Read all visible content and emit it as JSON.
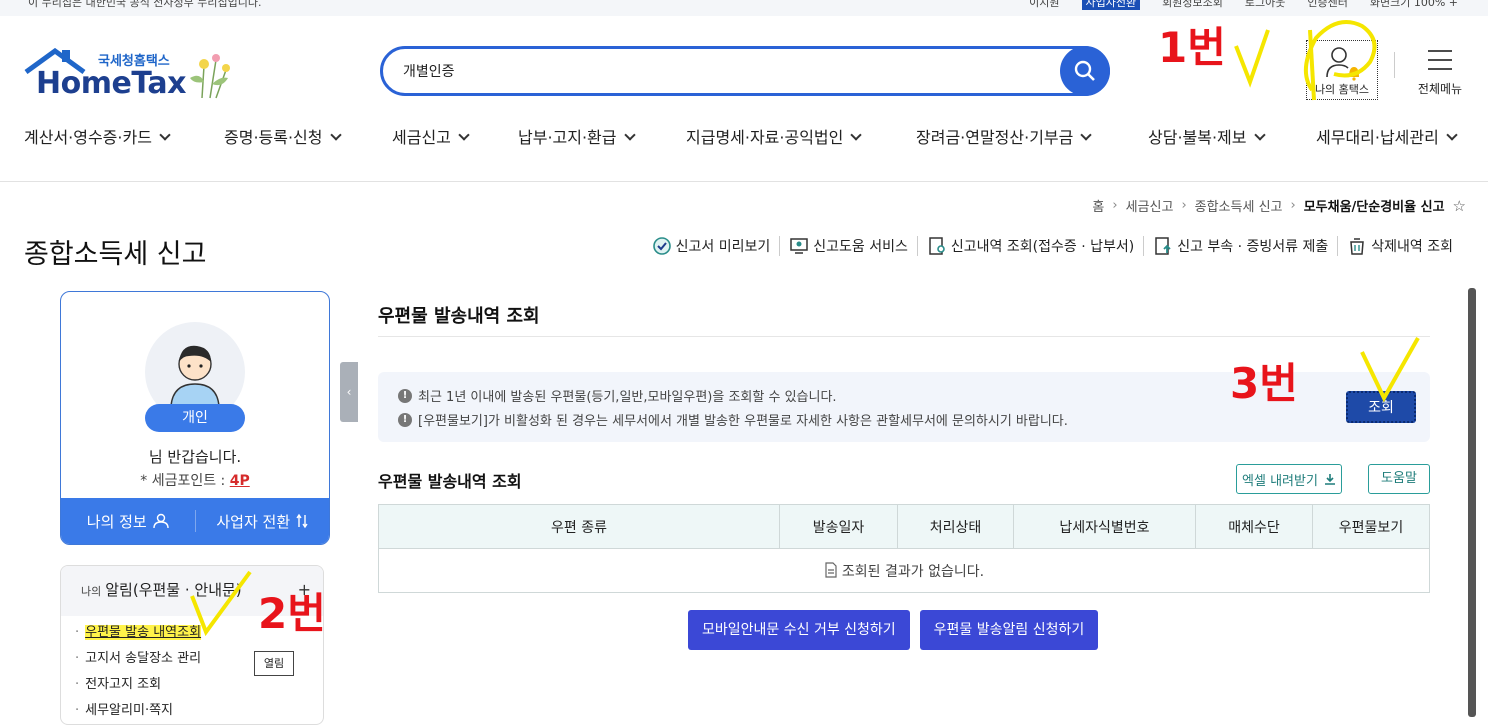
{
  "topbar": {
    "gov": "이 누리집은 대한민국 공식 전자정부 누리집입니다.",
    "links": [
      "이지원",
      "사업자전환",
      "회원정보조회",
      "로그아웃",
      "인증센터",
      "화면크기 100% +"
    ]
  },
  "logo": {
    "small": "국세청홈택스",
    "big": "HomeTax"
  },
  "search": {
    "value": "개별인증"
  },
  "header": {
    "my_hometax": "나의 홈택스",
    "all_menu": "전체메뉴"
  },
  "gnb": [
    "계산서·영수증·카드",
    "증명·등록·신청",
    "세금신고",
    "납부·고지·환급",
    "지급명세·자료·공익법인",
    "장려금·연말정산·기부금",
    "상담·불복·제보",
    "세무대리·납세관리"
  ],
  "breadcrumb": {
    "home": "홈",
    "l1": "세금신고",
    "l2": "종합소득세 신고",
    "current": "모두채움/단순경비율 신고",
    "star": "☆"
  },
  "page_title": "종합소득세 신고",
  "quick": [
    "신고서 미리보기",
    "신고도움 서비스",
    "신고내역 조회(접수증 · 납부서)",
    "신고 부속 · 증빙서류 제출",
    "삭제내역 조회"
  ],
  "profile": {
    "badge": "개인",
    "greeting": "님 반갑습니다.",
    "points_label": "* 세금포인트 :",
    "points_value": "4P",
    "my_info": "나의 정보",
    "switch": "사업자 전환"
  },
  "alarms": {
    "mini": "나의",
    "title": "알림(우편물 · 안내문)",
    "plus": "+",
    "items": [
      "우편물 발송 내역조회",
      "고지서 송달장소 관리",
      "전자고지 조회",
      "세무알리미·쪽지"
    ],
    "open_label": "열림"
  },
  "section": {
    "title": "우편물 발송내역 조회",
    "notice": [
      "최근 1년 이내에 발송된 우편물(등기,일반,모바일우편)을 조회할 수 있습니다.",
      "[우편물보기]가 비활성화 된 경우는 세무서에서 개별 발송한 우편물로 자세한 사항은 관할세무서에 문의하시기 바랍니다."
    ],
    "query_btn": "조회",
    "subtitle": "우편물 발송내역 조회",
    "excel_btn": "엑셀 내려받기",
    "help_btn": "도움말",
    "columns": [
      "우편 종류",
      "발송일자",
      "처리상태",
      "납세자식별번호",
      "매체수단",
      "우편물보기"
    ],
    "empty": "조회된 결과가 없습니다.",
    "btn_mobile_reject": "모바일안내문 수신 거부 신청하기",
    "btn_mail_alarm": "우편물 발송알림 신청하기"
  },
  "annotations": {
    "a1": "1번",
    "a2": "2번",
    "a3": "3번"
  },
  "colors": {
    "primary": "#2a62d6",
    "badge": "#3a7ae8",
    "action": "#3b48d6",
    "annotation": "#e8141b",
    "highlight": "#fff34a"
  }
}
